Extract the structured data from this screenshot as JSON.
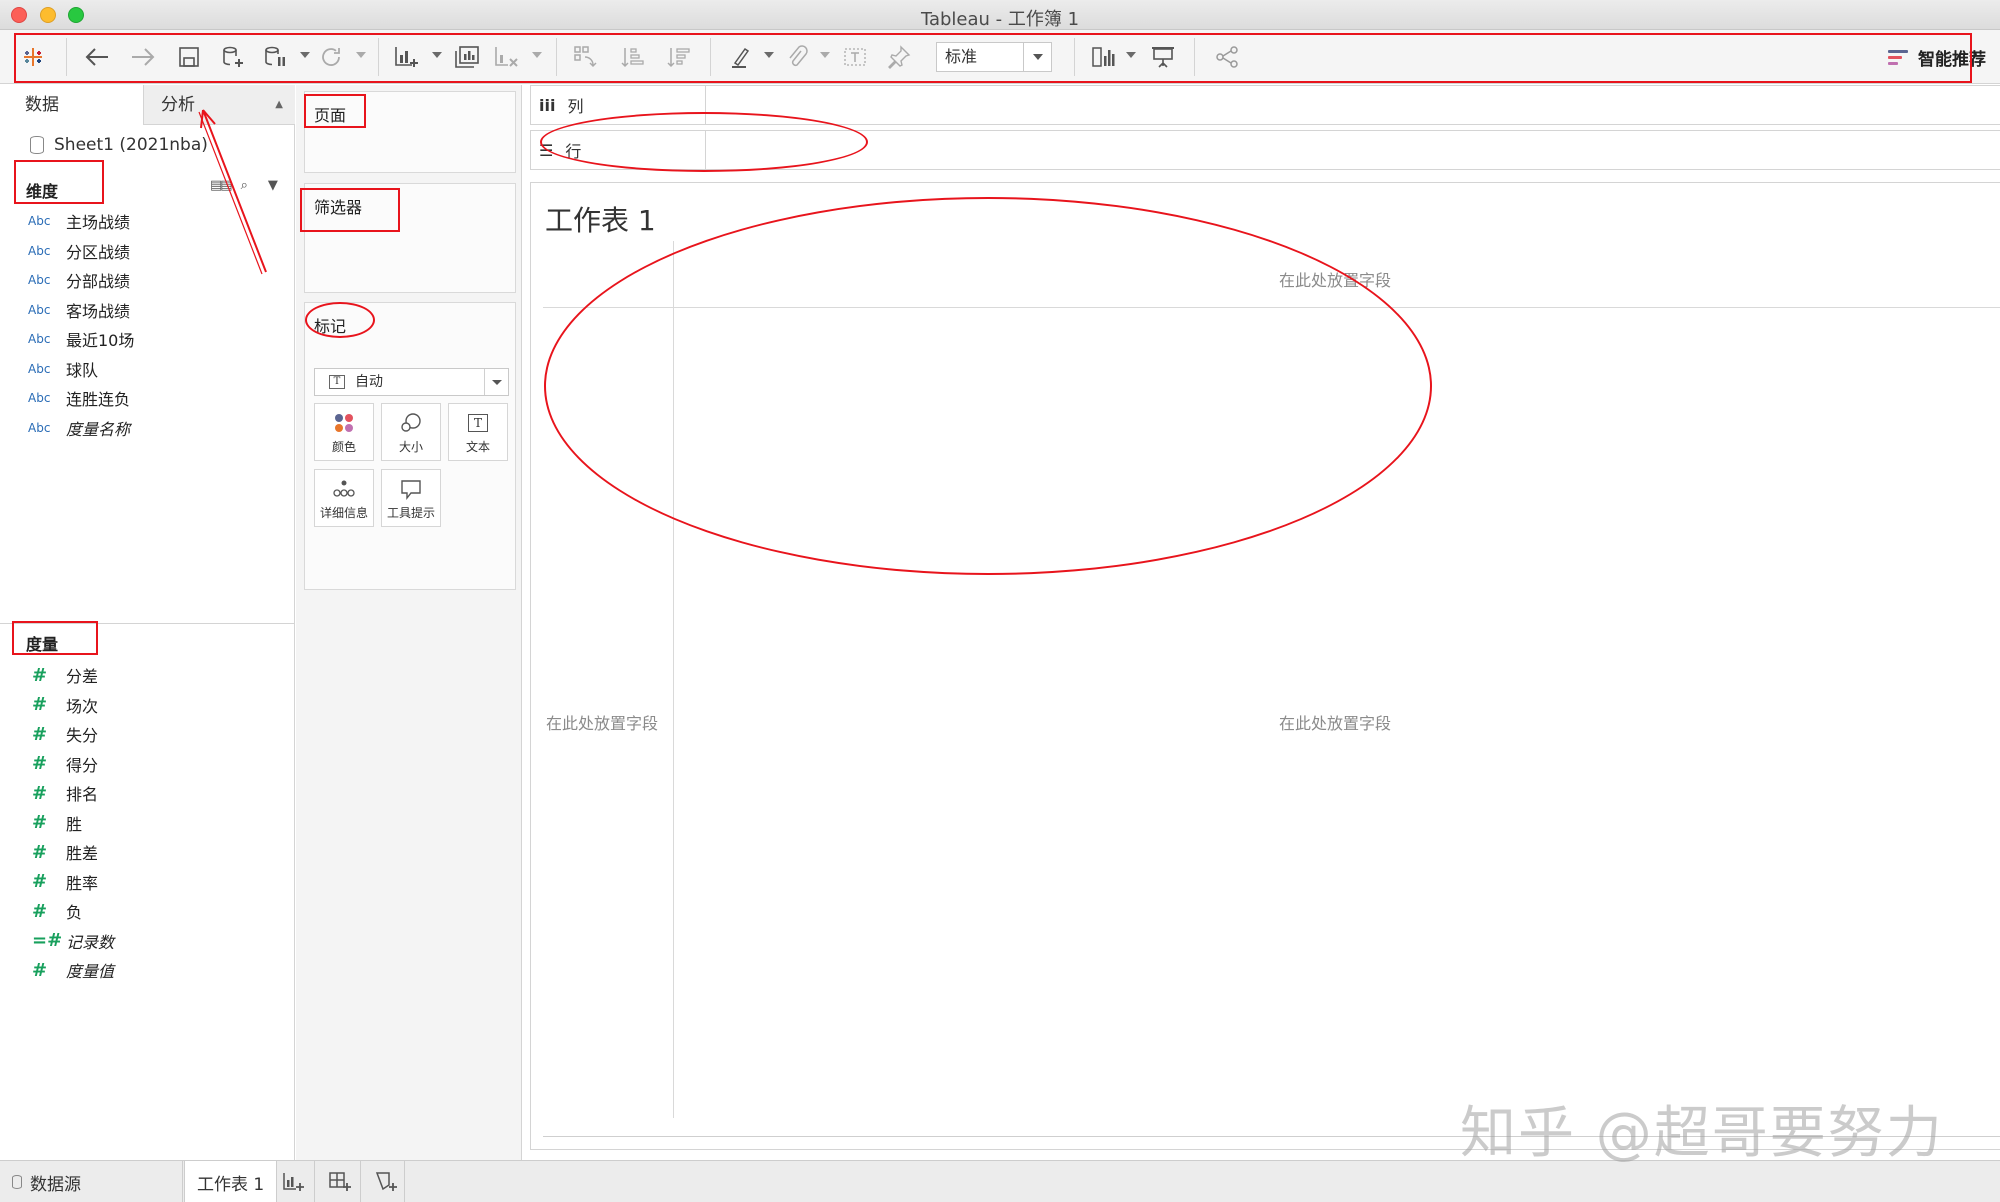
{
  "window": {
    "title": "Tableau - 工作簿 1"
  },
  "toolbar": {
    "mark_size_select": "标准",
    "show_me_label": "智能推荐"
  },
  "datapane": {
    "tab_data": "数据",
    "tab_analysis": "分析",
    "source_name": "Sheet1 (2021nba)",
    "dimensions_header": "维度",
    "dimensions": [
      {
        "type": "Abc",
        "label": "主场战绩"
      },
      {
        "type": "Abc",
        "label": "分区战绩"
      },
      {
        "type": "Abc",
        "label": "分部战绩"
      },
      {
        "type": "Abc",
        "label": "客场战绩"
      },
      {
        "type": "Abc",
        "label": "最近10场"
      },
      {
        "type": "Abc",
        "label": "球队"
      },
      {
        "type": "Abc",
        "label": "连胜连负"
      },
      {
        "type": "Abc",
        "label": "度量名称"
      }
    ],
    "measures_header": "度量",
    "measures": [
      {
        "type": "#",
        "label": "分差"
      },
      {
        "type": "#",
        "label": "场次"
      },
      {
        "type": "#",
        "label": "失分"
      },
      {
        "type": "#",
        "label": "得分"
      },
      {
        "type": "#",
        "label": "排名"
      },
      {
        "type": "#",
        "label": "胜"
      },
      {
        "type": "#",
        "label": "胜差"
      },
      {
        "type": "#",
        "label": "胜率"
      },
      {
        "type": "#",
        "label": "负"
      },
      {
        "type": "=#",
        "label": "记录数"
      },
      {
        "type": "#",
        "label": "度量值"
      }
    ]
  },
  "cards": {
    "pages": "页面",
    "filters": "筛选器",
    "marks": "标记",
    "mark_type": "自动",
    "mark_type_icon": "T",
    "text_icon": "T",
    "buttons": {
      "color": "颜色",
      "size": "大小",
      "text": "文本",
      "detail": "详细信息",
      "tooltip": "工具提示"
    }
  },
  "shelves": {
    "columns_icon": "iii",
    "columns": "列",
    "rows_icon": "☰",
    "rows": "行"
  },
  "canvas": {
    "sheet_title": "工作表 1",
    "drop_top": "在此处放置字段",
    "drop_left": "在此处放置字段",
    "drop_center": "在此处放置字段"
  },
  "bottombar": {
    "datasource": "数据源",
    "sheet_tab": "工作表 1"
  },
  "watermark": "知乎 @超哥要努力",
  "colors": {
    "annotation_red": "#e8141c",
    "abc_blue": "#2a6cb6",
    "measure_green": "#18a05d"
  }
}
